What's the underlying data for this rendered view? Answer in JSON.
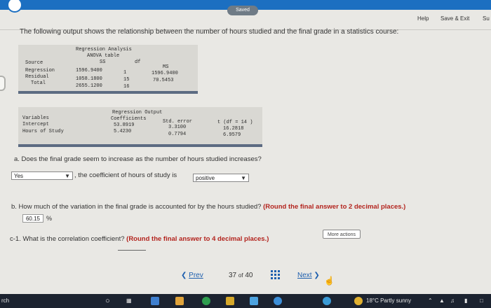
{
  "header": {
    "saved_label": "Saved",
    "help_label": "Help",
    "save_exit_label": "Save & Exit",
    "submit_label": "Su"
  },
  "prompt": "The following output shows the relationship between the number of hours studied and the final grade in a statistics course:",
  "anova": {
    "title1": "Regression Analysis",
    "title2": "ANOVA table",
    "col_source": "Source",
    "col_ss": "SS",
    "col_df": "df",
    "col_ms": "MS",
    "rows": [
      {
        "source": "Regression",
        "ss": "1596.9400",
        "df": "1",
        "ms": "1596.9400"
      },
      {
        "source": "Residual",
        "ss": "1058.1800",
        "df": "15",
        "ms": "70.5453"
      },
      {
        "source": "Total",
        "ss": "2655.1200",
        "df": "16",
        "ms": ""
      }
    ]
  },
  "regression": {
    "title1": "Regression Output",
    "col_variables": "Variables",
    "col_coefficients": "Coefficients",
    "col_stderr": "Std. error",
    "col_t": "t (df = 14 )",
    "rows": [
      {
        "variable": "Intercept",
        "coef": "53.8919",
        "se": "3.3100",
        "t": "16.2818"
      },
      {
        "variable": "Hours of Study",
        "coef": "5.4230",
        "se": "0.7794",
        "t": "6.9579"
      }
    ]
  },
  "question_a": {
    "text": "a. Does the final grade seem to increase as the number of hours studied increases?",
    "select_value": "Yes",
    "middle_text": ", the coefficient of hours of study is",
    "select2_value": "positive"
  },
  "question_b": {
    "text": "b. How much of the variation in the final grade is accounted for by the hours studied?",
    "instruction": "(Round the final answer to 2 decimal places.)",
    "answer_value": "60.15",
    "unit": "%"
  },
  "question_c1": {
    "text": "c-1. What is the correlation coefficient?",
    "instruction": "(Round the final answer to 4 decimal places.)",
    "more_actions": "More actions"
  },
  "navigation": {
    "prev": "Prev",
    "current": "37",
    "of": "of",
    "total": "40",
    "next": "Next"
  },
  "taskbar": {
    "search_stub": "rch",
    "weather": "18°C  Partly sunny"
  },
  "colors": {
    "topbar": "#1c6fc1",
    "accent_red": "#b3241e",
    "table_bar": "#5c6b82"
  }
}
